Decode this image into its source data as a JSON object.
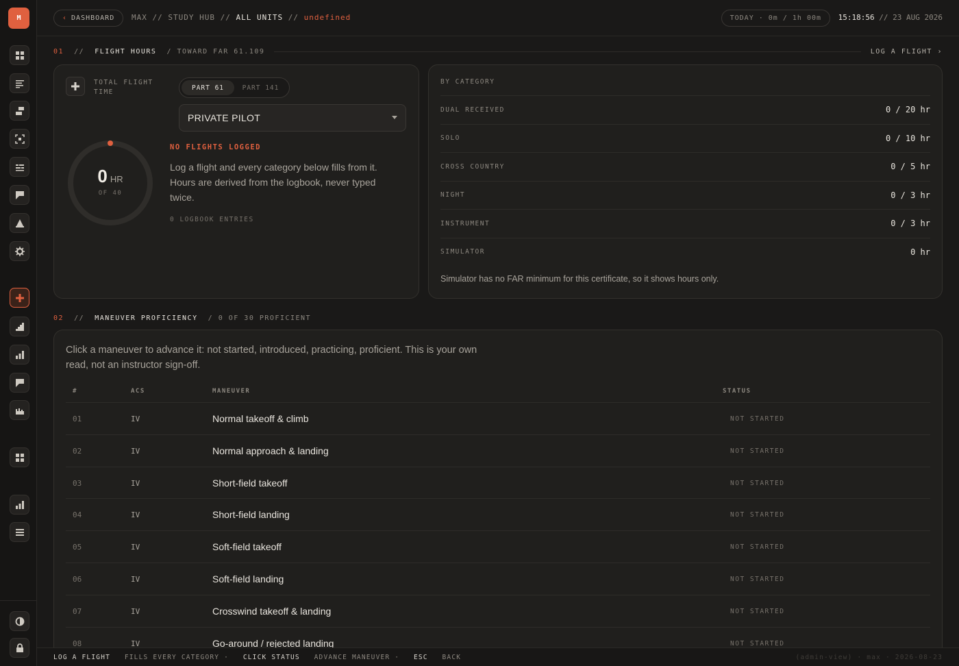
{
  "app": {
    "logo_letter": "M",
    "colors": {
      "accent": "#e0603f",
      "background": "#1a1918",
      "card": "#201f1d"
    }
  },
  "sidebar": {
    "items": [
      {
        "icon": "dashboard-grid-icon",
        "active": false
      },
      {
        "icon": "list-lines-icon",
        "active": false
      },
      {
        "icon": "layers-icon",
        "active": false
      },
      {
        "icon": "focus-frame-icon",
        "active": false
      },
      {
        "icon": "table-rows-icon",
        "active": false
      },
      {
        "icon": "flag-icon",
        "active": false
      },
      {
        "icon": "tent-icon",
        "active": false
      },
      {
        "icon": "gear-icon",
        "active": false
      },
      {
        "icon": "plus-icon",
        "active": true
      },
      {
        "icon": "stairs-chart-icon",
        "active": false
      },
      {
        "icon": "bar-chart-icon",
        "active": false
      },
      {
        "icon": "flag-icon",
        "active": false
      },
      {
        "icon": "skyline-icon",
        "active": false
      },
      {
        "icon": "dashboard-grid-icon",
        "active": false
      },
      {
        "icon": "bar-chart-icon",
        "active": false
      },
      {
        "icon": "menu-lines-icon",
        "active": false
      },
      {
        "icon": "contrast-icon",
        "active": false
      },
      {
        "icon": "lock-icon",
        "active": false
      }
    ]
  },
  "topbar": {
    "back_label": "DASHBOARD",
    "crumb_user": "MAX",
    "crumb_sep": "//",
    "crumb_hub": "STUDY HUB",
    "crumb_current": "ALL UNITS",
    "crumb_undefined": "undefined",
    "today_pill": "TODAY · 0m / 1h 00m",
    "time": "15:18:56",
    "date": "// 23 AUG 2026"
  },
  "section1": {
    "num": "01",
    "sep": "//",
    "title": "FLIGHT HOURS",
    "subtitle": "/ TOWARD FAR 61.109",
    "link": "LOG A FLIGHT ›"
  },
  "hours_card": {
    "total_label": "TOTAL FLIGHT TIME",
    "seg_part61": "PART 61",
    "seg_part141": "PART 141",
    "certificate": "PRIVATE PILOT",
    "progress_fraction": 0,
    "hours_value": "0",
    "hours_unit": "HR",
    "hours_target": "OF 40",
    "empty_title": "NO FLIGHTS LOGGED",
    "empty_body": "Log a flight and every category below fills from it. Hours are derived from the logbook, never typed twice.",
    "entries": "0 LOGBOOK ENTRIES"
  },
  "category_card": {
    "header": "BY CATEGORY",
    "rows": [
      {
        "name": "DUAL RECEIVED",
        "value": "0 / 20 hr"
      },
      {
        "name": "SOLO",
        "value": "0 / 10 hr"
      },
      {
        "name": "CROSS COUNTRY",
        "value": "0 / 5 hr"
      },
      {
        "name": "NIGHT",
        "value": "0 / 3 hr"
      },
      {
        "name": "INSTRUMENT",
        "value": "0 / 3 hr"
      },
      {
        "name": "SIMULATOR",
        "value": "0 hr"
      }
    ],
    "note": "Simulator has no FAR minimum for this certificate, so it shows hours only."
  },
  "section2": {
    "num": "02",
    "sep": "//",
    "title": "MANEUVER PROFICIENCY",
    "subtitle": "/ 0 OF 30 PROFICIENT"
  },
  "maneuvers": {
    "intro": "Click a maneuver to advance it: not started, introduced, practicing, proficient. This is your own read, not an instructor sign-off.",
    "headers": {
      "num": "#",
      "acs": "ACS",
      "maneuver": "MANEUVER",
      "status": "STATUS"
    },
    "rows": [
      {
        "num": "01",
        "acs": "IV",
        "name": "Normal takeoff & climb",
        "status": "NOT STARTED"
      },
      {
        "num": "02",
        "acs": "IV",
        "name": "Normal approach & landing",
        "status": "NOT STARTED"
      },
      {
        "num": "03",
        "acs": "IV",
        "name": "Short-field takeoff",
        "status": "NOT STARTED"
      },
      {
        "num": "04",
        "acs": "IV",
        "name": "Short-field landing",
        "status": "NOT STARTED"
      },
      {
        "num": "05",
        "acs": "IV",
        "name": "Soft-field takeoff",
        "status": "NOT STARTED"
      },
      {
        "num": "06",
        "acs": "IV",
        "name": "Soft-field landing",
        "status": "NOT STARTED"
      },
      {
        "num": "07",
        "acs": "IV",
        "name": "Crosswind takeoff & landing",
        "status": "NOT STARTED"
      },
      {
        "num": "08",
        "acs": "IV",
        "name": "Go-around / rejected landing",
        "status": "NOT STARTED"
      }
    ]
  },
  "footer": {
    "hint1_key": "LOG A FLIGHT",
    "hint1_desc": "FILLS EVERY CATEGORY ·",
    "hint2_key": "CLICK STATUS",
    "hint2_desc": "ADVANCE MANEUVER ·",
    "hint3_key": "ESC",
    "hint3_desc": "BACK",
    "meta": "(admin-view) · max · 2026-08-23"
  }
}
